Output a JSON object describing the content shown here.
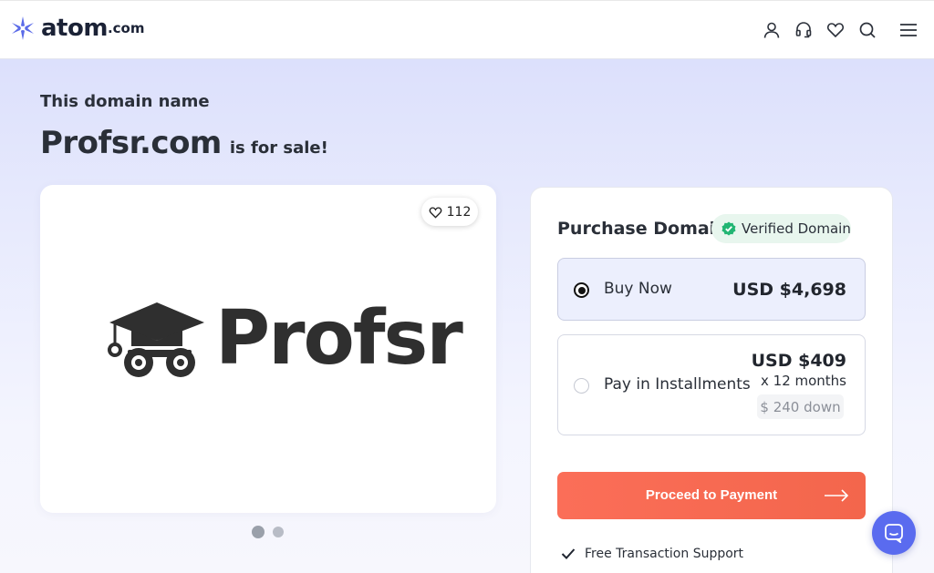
{
  "header": {
    "logo_name": "atom",
    "logo_tld": ".com",
    "icons": [
      "user-icon",
      "headset-icon",
      "heart-icon",
      "search-icon",
      "menu-icon"
    ]
  },
  "hero": {
    "eyebrow": "This domain name",
    "domain": "Profsr.com",
    "suffix": "is for sale!"
  },
  "gallery": {
    "likes": "112",
    "brand_word": "Profsr",
    "slides": 2,
    "active_slide": 1
  },
  "purchase": {
    "title": "Purchase Domain",
    "verified_label": "Verified Domain",
    "options": [
      {
        "label": "Buy Now",
        "price": "USD $4,698",
        "selected": true
      },
      {
        "label": "Pay in Installments",
        "price": "USD $409",
        "term": "x 12 months",
        "down": "$ 240 down",
        "selected": false
      }
    ],
    "cta_label": "Proceed to Payment",
    "features": [
      "Free Transaction Support"
    ]
  },
  "colors": {
    "accent": "#f36a50",
    "brand": "#5a6bef",
    "verified": "#22b573"
  }
}
